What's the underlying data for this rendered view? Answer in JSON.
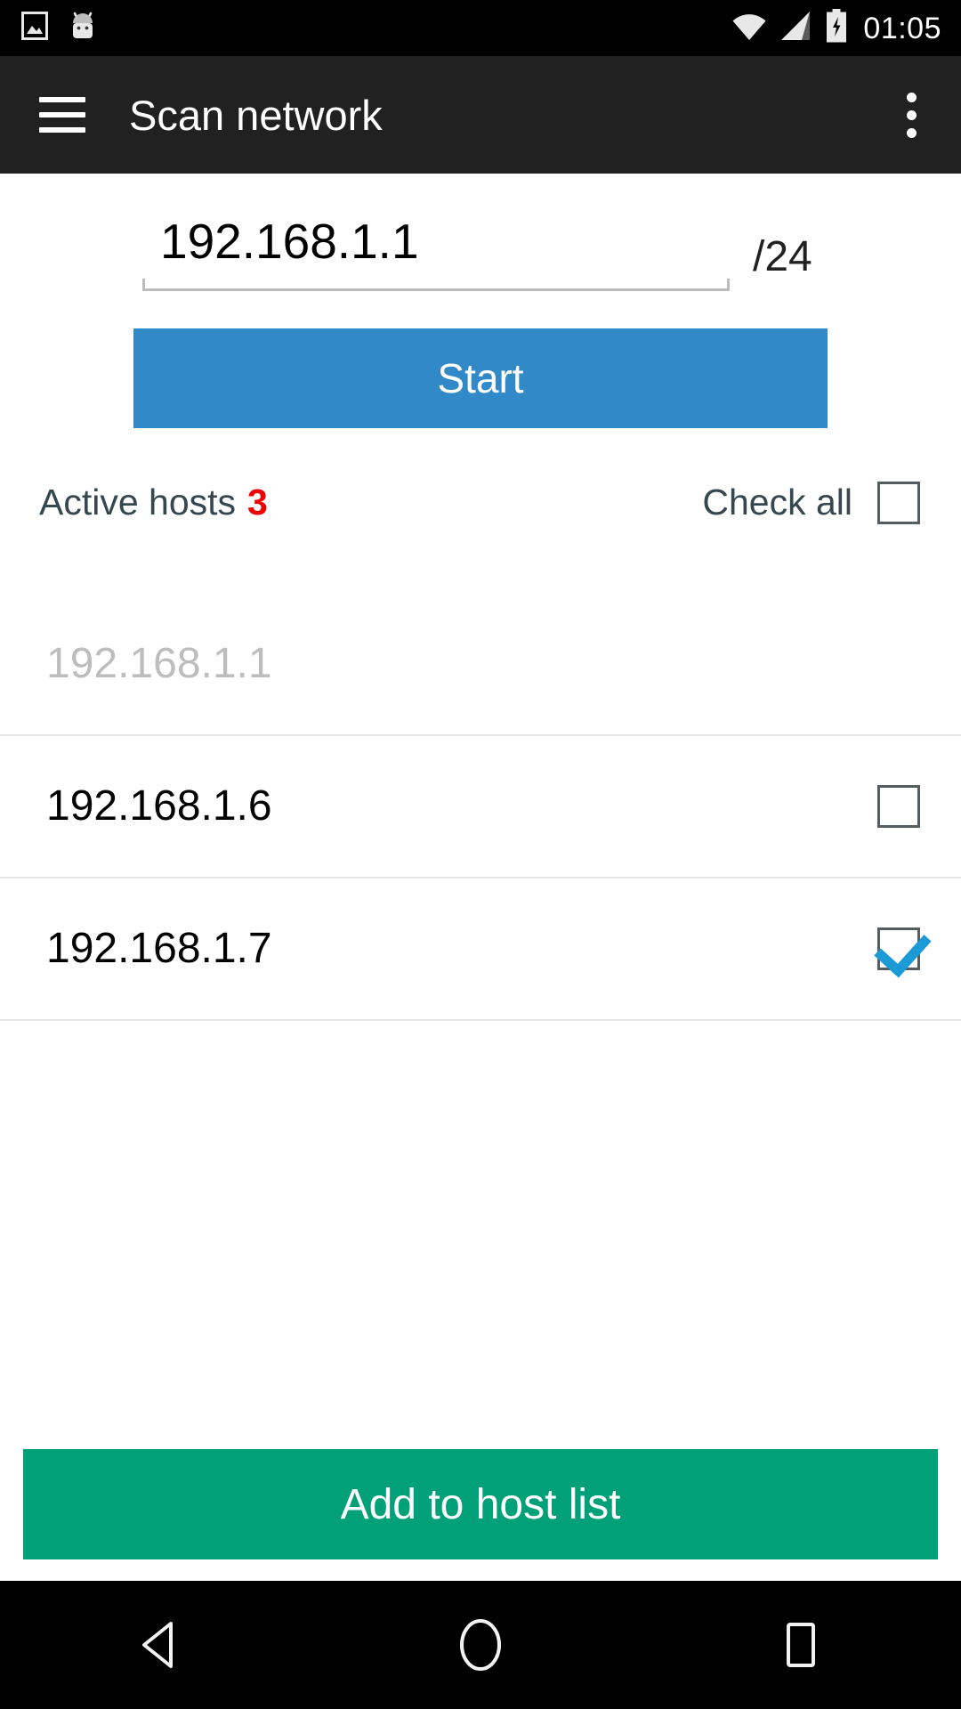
{
  "status_bar": {
    "time": "01:05",
    "icons": {
      "screenshot": "image-icon",
      "android": "android-robot-icon",
      "wifi": "wifi-icon",
      "signal": "cellular-signal-icon",
      "battery": "battery-charging-icon"
    },
    "background": "#000000"
  },
  "app_bar": {
    "title": "Scan network",
    "menu_icon": "hamburger-menu-icon",
    "overflow_icon": "overflow-menu-icon",
    "background": "#212121",
    "text_color": "#ffffff"
  },
  "scan_form": {
    "ip_value": "192.168.1.1",
    "ip_placeholder": "192.168.1.1",
    "cidr_suffix": "/24",
    "start_label": "Start",
    "start_color": "#3289c8"
  },
  "results_header": {
    "active_hosts_label": "Active hosts",
    "active_hosts_count": "3",
    "count_color": "#ee0000",
    "check_all_label": "Check all",
    "check_all_checked": false
  },
  "hosts": [
    {
      "ip": "192.168.1.1",
      "disabled": true,
      "checked": false,
      "show_checkbox": false
    },
    {
      "ip": "192.168.1.6",
      "disabled": false,
      "checked": false,
      "show_checkbox": true
    },
    {
      "ip": "192.168.1.7",
      "disabled": false,
      "checked": true,
      "show_checkbox": true
    }
  ],
  "bottom_action": {
    "label": "Add to host list",
    "color": "#00a178"
  },
  "nav_bar": {
    "back": "back-triangle-icon",
    "home": "home-circle-icon",
    "recents": "recents-square-icon",
    "background": "#000000"
  }
}
